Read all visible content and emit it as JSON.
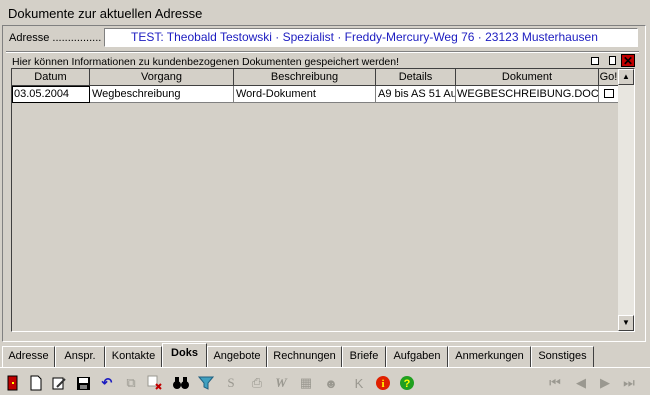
{
  "window_title": "Dokumente zur aktuellen Adresse",
  "address": {
    "label": "Adresse ................",
    "value": "TEST: Theobald Testowski · Spezialist · Freddy-Mercury-Weg 76 · 23123 Musterhausen"
  },
  "info_text": "Hier können Informationen zu kundenbezogenen Dokumenten gespeichert werden!",
  "grid": {
    "columns": [
      "Datum",
      "Vorgang",
      "Beschreibung",
      "Details",
      "Dokument",
      "Go!"
    ],
    "rows": [
      {
        "datum": "03.05.2004",
        "vorgang": "Wegbeschreibung",
        "beschreibung": "Word-Dokument",
        "details": "A9 bis AS 51 Au",
        "dokument": "WEGBESCHREIBUNG.DOC"
      }
    ]
  },
  "tabs": [
    "Adresse",
    "Anspr.",
    "Kontakte",
    "Doks",
    "Angebote",
    "Rechnungen",
    "Briefe",
    "Aufgaben",
    "Anmerkungen",
    "Sonstiges"
  ],
  "active_tab": "Doks",
  "toolbar_icons": [
    "exit-door-icon",
    "new-document-icon",
    "edit-icon",
    "save-disk-icon",
    "undo-icon",
    "copy-icon",
    "delete-icon",
    "binoculars-search-icon",
    "filter-funnel-icon",
    "s-icon",
    "print-icon",
    "word-w-icon",
    "table-icon",
    "person-icon",
    "k-icon",
    "info-icon",
    "help-icon",
    "first-record-icon",
    "prev-record-icon",
    "next-record-icon",
    "last-record-icon"
  ],
  "colors": {
    "address_text": "#1c1cc0",
    "background": "#d4d0c8"
  }
}
